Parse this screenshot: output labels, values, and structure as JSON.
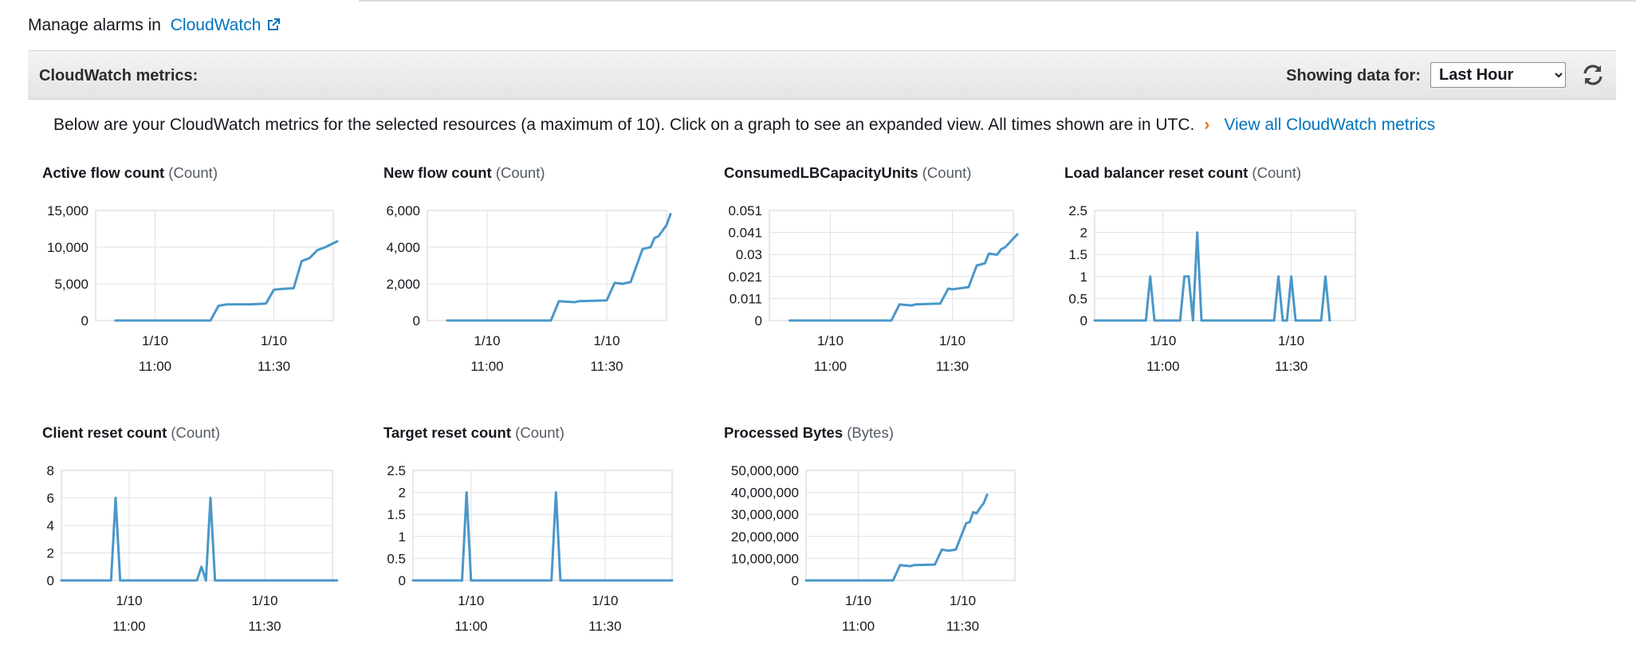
{
  "alarms": {
    "prefix": "Manage alarms in",
    "link": "CloudWatch"
  },
  "header": {
    "title": "CloudWatch metrics:",
    "showing_label": "Showing data for:",
    "range_selected": "Last Hour"
  },
  "description": {
    "text": "Below are your CloudWatch metrics for the selected resources (a maximum of 10). Click on a graph to see an expanded view. All times shown are in UTC.",
    "arrow": "›",
    "link": "View all CloudWatch metrics"
  },
  "colors": {
    "line": "#4a97c9",
    "grid": "#e1e1e1",
    "link": "#0073bb",
    "accent": "#ec7211"
  },
  "icons": {
    "external": "external-link-icon",
    "refresh": "refresh-icon",
    "dropdown": "chevron-down-icon"
  },
  "chart_data": [
    {
      "type": "line",
      "title": "Active flow count",
      "unit": "(Count)",
      "yticks": [
        "15,000",
        "10,000",
        "5,000",
        "0"
      ],
      "ylim": [
        0,
        15000
      ],
      "xticks": [
        {
          "date": "1/10",
          "time": "11:00",
          "minute": 10
        },
        {
          "date": "1/10",
          "time": "11:30",
          "minute": 40
        }
      ],
      "xrange": [
        -5,
        55
      ],
      "x": [
        0,
        24,
        26,
        28,
        34,
        38,
        40,
        42,
        45,
        47,
        49,
        51,
        53,
        56
      ],
      "values": [
        0,
        0,
        2000,
        2200,
        2200,
        2300,
        4200,
        4300,
        4400,
        8100,
        8500,
        9600,
        10000,
        10800
      ]
    },
    {
      "type": "line",
      "title": "New flow count",
      "unit": "(Count)",
      "yticks": [
        "6,000",
        "4,000",
        "2,000",
        "0"
      ],
      "ylim": [
        0,
        6000
      ],
      "xticks": [
        {
          "date": "1/10",
          "time": "11:00",
          "minute": 10
        },
        {
          "date": "1/10",
          "time": "11:30",
          "minute": 40
        }
      ],
      "xrange": [
        -5,
        55
      ],
      "x": [
        0,
        26,
        28,
        32,
        33,
        40,
        42,
        44,
        46,
        49,
        51,
        52,
        53,
        55,
        56
      ],
      "values": [
        0,
        0,
        1050,
        1000,
        1050,
        1100,
        2050,
        2000,
        2100,
        3900,
        4000,
        4500,
        4600,
        5200,
        5800
      ]
    },
    {
      "type": "line",
      "title": "ConsumedLBCapacityUnits",
      "unit": "(Count)",
      "yticks": [
        "0.051",
        "0.041",
        "0.03",
        "0.021",
        "0.011",
        "0"
      ],
      "ylim": [
        0,
        0.051
      ],
      "xticks": [
        {
          "date": "1/10",
          "time": "11:00",
          "minute": 10
        },
        {
          "date": "1/10",
          "time": "11:30",
          "minute": 40
        }
      ],
      "xrange": [
        -5,
        55
      ],
      "x": [
        0,
        25,
        27,
        30,
        31,
        36,
        37,
        39,
        40,
        44,
        46,
        48,
        49,
        51,
        52,
        53,
        54,
        56
      ],
      "values": [
        0,
        0,
        0.0075,
        0.007,
        0.0075,
        0.0078,
        0.0078,
        0.0148,
        0.0145,
        0.0155,
        0.0255,
        0.0265,
        0.031,
        0.0305,
        0.033,
        0.034,
        0.036,
        0.04
      ]
    },
    {
      "type": "line",
      "title": "Load balancer reset count",
      "unit": "(Count)",
      "yticks": [
        "2.5",
        "2",
        "1.5",
        "1",
        "0.5",
        "0"
      ],
      "ylim": [
        0,
        2.5
      ],
      "xticks": [
        {
          "date": "1/10",
          "time": "11:00",
          "minute": 10
        },
        {
          "date": "1/10",
          "time": "11:30",
          "minute": 40
        }
      ],
      "xrange": [
        -6,
        55
      ],
      "x": [
        -6,
        6,
        7,
        8,
        14,
        15,
        16,
        17,
        18,
        19,
        36,
        37,
        38,
        39,
        40,
        41,
        47,
        48,
        49
      ],
      "values": [
        0,
        0,
        1,
        0,
        0,
        1,
        1,
        0,
        2,
        0,
        0,
        1,
        0,
        0,
        1,
        0,
        0,
        1,
        0
      ]
    },
    {
      "type": "line",
      "title": "Client reset count",
      "unit": "(Count)",
      "yticks": [
        "8",
        "6",
        "4",
        "2",
        "0"
      ],
      "ylim": [
        0,
        8
      ],
      "xticks": [
        {
          "date": "1/10",
          "time": "11:00",
          "minute": 10
        },
        {
          "date": "1/10",
          "time": "11:30",
          "minute": 40
        }
      ],
      "xrange": [
        -5,
        55
      ],
      "x": [
        -5,
        6,
        7,
        8,
        25,
        26,
        27,
        28,
        29,
        56
      ],
      "values": [
        0,
        0,
        6,
        0,
        0,
        1,
        0,
        6,
        0,
        0
      ]
    },
    {
      "type": "line",
      "title": "Target reset count",
      "unit": "(Count)",
      "yticks": [
        "2.5",
        "2",
        "1.5",
        "1",
        "0.5",
        "0"
      ],
      "ylim": [
        0,
        2.5
      ],
      "xticks": [
        {
          "date": "1/10",
          "time": "11:00",
          "minute": 10
        },
        {
          "date": "1/10",
          "time": "11:30",
          "minute": 40
        }
      ],
      "xrange": [
        -3,
        55
      ],
      "x": [
        -3,
        8,
        9,
        10,
        28,
        29,
        30,
        55
      ],
      "values": [
        0,
        0,
        2,
        0,
        0,
        2,
        0,
        0
      ]
    },
    {
      "type": "line",
      "title": "Processed Bytes",
      "unit": "(Bytes)",
      "yticks": [
        "50,000,000",
        "40,000,000",
        "30,000,000",
        "20,000,000",
        "10,000,000",
        "0"
      ],
      "ylim": [
        0,
        50000000
      ],
      "xticks": [
        {
          "date": "1/10",
          "time": "11:00",
          "minute": 10
        },
        {
          "date": "1/10",
          "time": "11:30",
          "minute": 40
        }
      ],
      "xrange": [
        -5,
        55
      ],
      "x": [
        -5,
        20,
        22,
        25,
        26,
        32,
        34,
        36,
        38,
        41,
        42,
        43,
        44,
        45,
        46,
        47
      ],
      "values": [
        0,
        0,
        7000000,
        6500000,
        7000000,
        7200000,
        14000000,
        13500000,
        14000000,
        26000000,
        26500000,
        31000000,
        30500000,
        33000000,
        35000000,
        39000000
      ]
    }
  ]
}
